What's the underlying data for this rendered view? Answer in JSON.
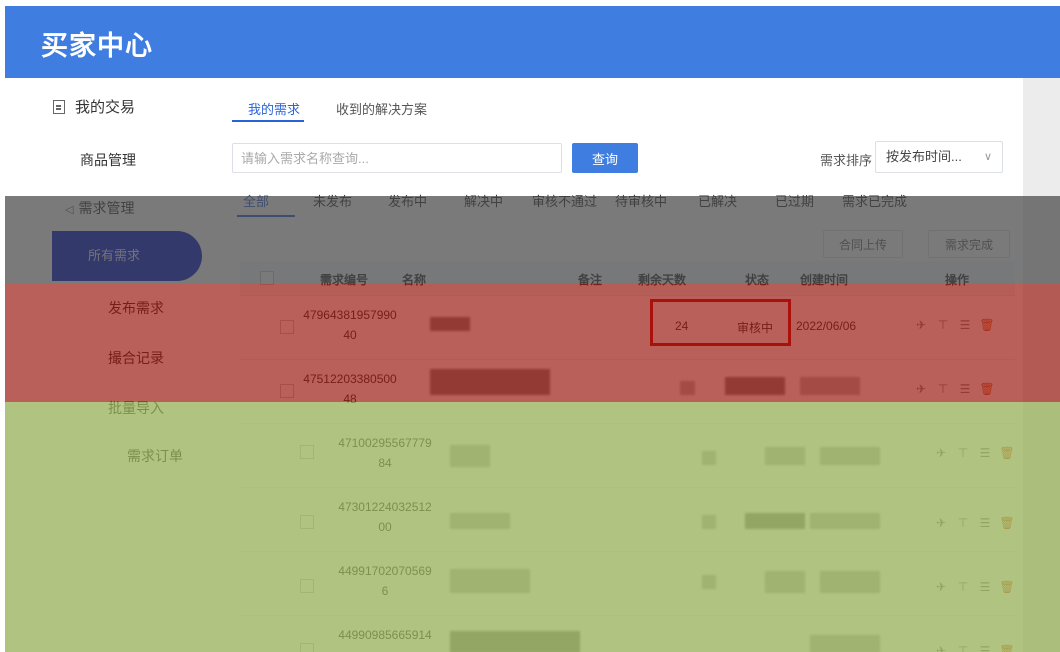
{
  "header": {
    "title": "买家中心"
  },
  "sidebar": {
    "heading": "我的交易",
    "items": [
      {
        "label": "商品管理"
      },
      {
        "label": "需求管理"
      },
      {
        "label": "所有需求",
        "active": true
      },
      {
        "label": "发布需求"
      },
      {
        "label": "撮合记录"
      },
      {
        "label": "批量导入"
      },
      {
        "label": "需求订单"
      }
    ]
  },
  "tabs": [
    {
      "label": "我的需求",
      "active": true
    },
    {
      "label": "收到的解决方案"
    }
  ],
  "search": {
    "placeholder": "请输入需求名称查询...",
    "button": "查询"
  },
  "sort": {
    "label": "需求排序",
    "value": "按发布时间..."
  },
  "status_tabs": [
    "全部",
    "未发布",
    "发布中",
    "解决中",
    "审核不通过",
    "待审核中",
    "已解决",
    "已过期",
    "需求已完成"
  ],
  "actions": {
    "contract_upload": "合同上传",
    "complete": "需求完成"
  },
  "table": {
    "columns": [
      "需求编号",
      "名称",
      "备注",
      "剩余天数",
      "状态",
      "创建时间",
      "操作"
    ],
    "rows": [
      {
        "id": "4796438195799040",
        "name": "",
        "remark": "",
        "days": "24",
        "status": "审核中",
        "created": "2022/06/06"
      },
      {
        "id": "4751220338050048",
        "name": "",
        "remark": "",
        "days": "",
        "status": "",
        "created": ""
      },
      {
        "id": "4710029556777984",
        "name": "",
        "remark": "",
        "days": "",
        "status": "",
        "created": ""
      },
      {
        "id": "4730122403251200",
        "name": "",
        "remark": "",
        "days": "",
        "status": "",
        "created": ""
      },
      {
        "id": "449917020705696",
        "name": "",
        "remark": "",
        "days": "",
        "status": "",
        "created": ""
      },
      {
        "id": "44990985665914",
        "name": "",
        "remark": "",
        "days": "",
        "status": "",
        "created": ""
      }
    ]
  },
  "colors": {
    "brand": "#3f7de0",
    "sidebar_active": "#0016c8",
    "highlight": "#d10a0a",
    "delete": "#e0622a"
  },
  "icons": [
    "document-icon",
    "megaphone-icon",
    "send-icon",
    "pin-top-icon",
    "note-icon",
    "trash-icon",
    "chevron-down-icon"
  ]
}
